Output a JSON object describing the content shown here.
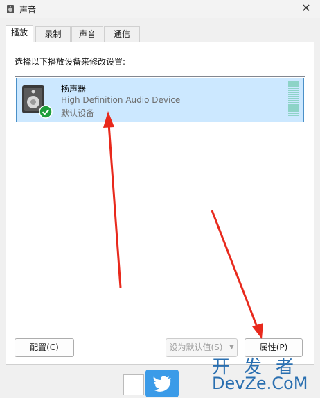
{
  "window": {
    "title": "声音",
    "close_symbol": "✕"
  },
  "tabs": [
    {
      "label": "播放",
      "active": true
    },
    {
      "label": "录制",
      "active": false
    },
    {
      "label": "声音",
      "active": false
    },
    {
      "label": "通信",
      "active": false
    }
  ],
  "panel": {
    "instruction": "选择以下播放设备来修改设置:",
    "devices": [
      {
        "name": "扬声器",
        "description": "High Definition Audio Device",
        "status": "默认设备",
        "icon": "speaker-icon",
        "default_badge": "green-check-icon"
      }
    ]
  },
  "buttons": {
    "configure": "配置(C)",
    "set_default": "设为默认值(S)",
    "set_default_arrow": "▼",
    "properties": "属性(P)"
  },
  "watermark": {
    "top": "开发者",
    "bottom": "DevZe.CoM"
  },
  "colors": {
    "selection_bg": "#cce8ff",
    "selection_border": "#4a90c8",
    "arrow": "#e8291c",
    "check": "#1e9e3c"
  }
}
